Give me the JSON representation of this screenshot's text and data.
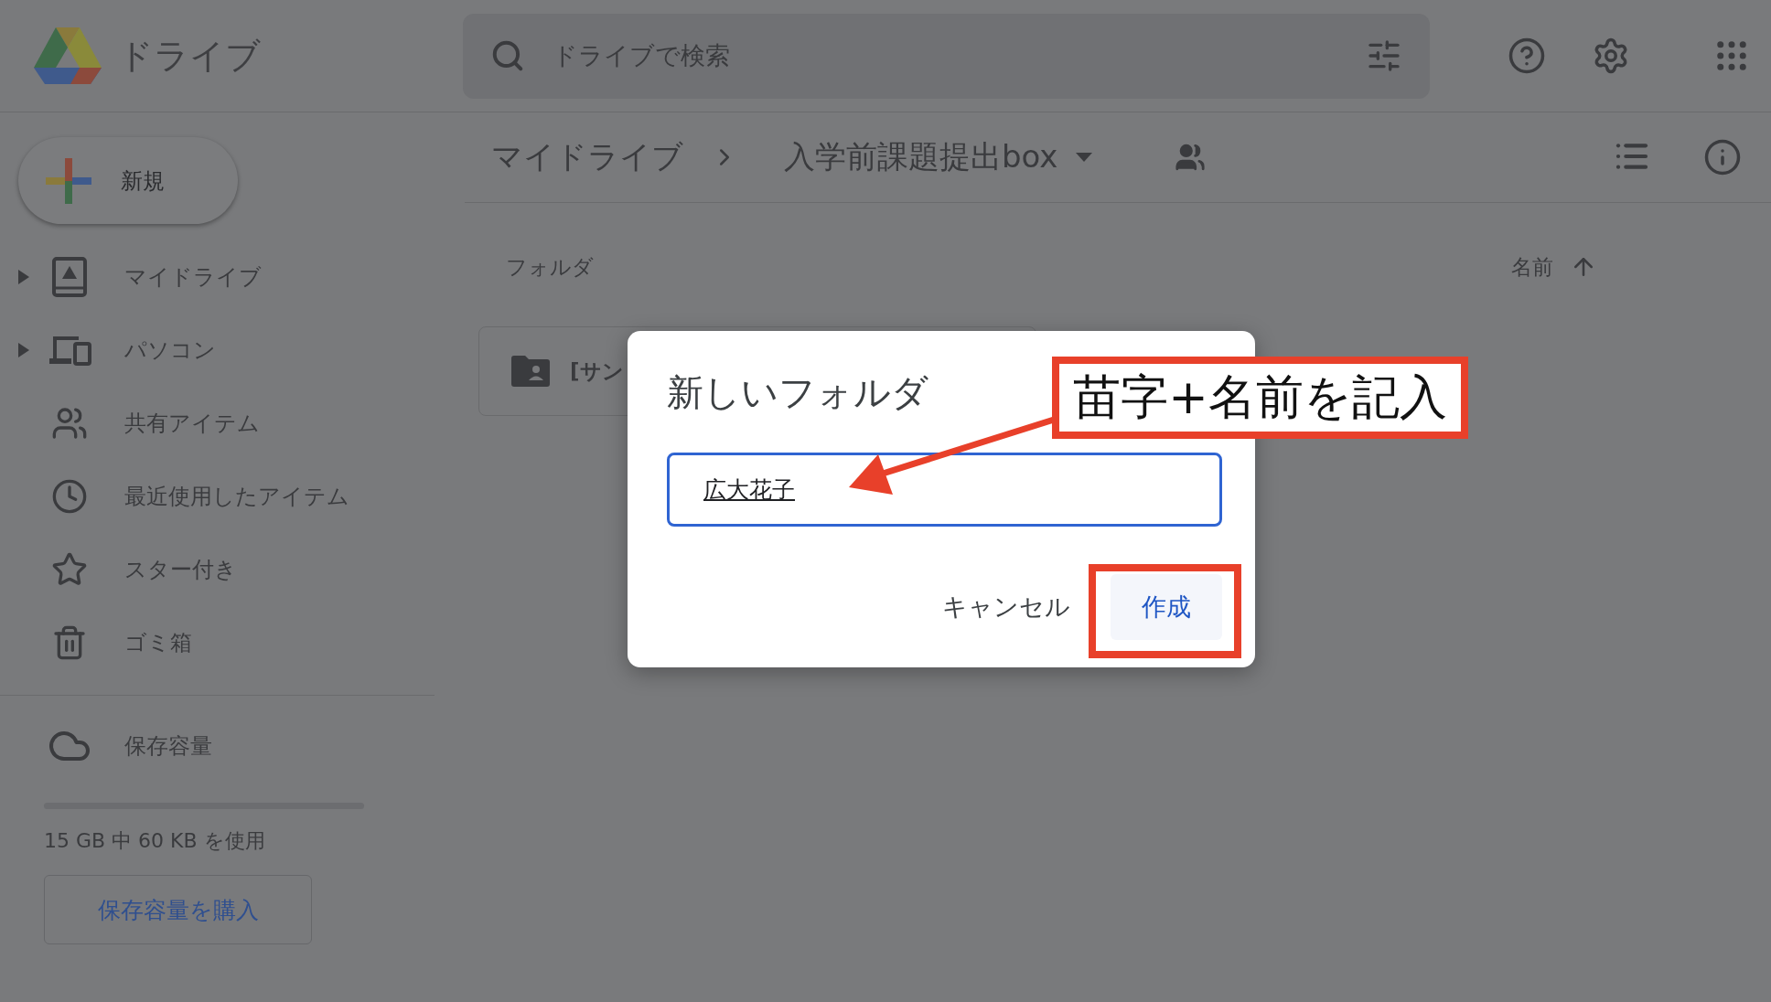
{
  "header": {
    "app_name": "ドライブ",
    "search": {
      "placeholder": "ドライブで検索"
    }
  },
  "breadcrumb": {
    "items": [
      "マイドライブ",
      "入学前課題提出box"
    ]
  },
  "sidebar": {
    "new_button": "新規",
    "items": [
      {
        "label": "マイドライブ",
        "kind": "drive",
        "expandable": true
      },
      {
        "label": "パソコン",
        "kind": "computer",
        "expandable": true
      },
      {
        "label": "共有アイテム",
        "kind": "shared",
        "expandable": false
      },
      {
        "label": "最近使用したアイテム",
        "kind": "recent",
        "expandable": false
      },
      {
        "label": "スター付き",
        "kind": "star",
        "expandable": false
      },
      {
        "label": "ゴミ箱",
        "kind": "trash",
        "expandable": false
      }
    ],
    "storage": {
      "label": "保存容量",
      "level": 0.0,
      "usage": "15 GB 中 60 KB を使用",
      "buy_button": "保存容量を購入"
    }
  },
  "content": {
    "section_title": "フォルダ",
    "sort_label": "名前",
    "folders": [
      {
        "name": "[サン"
      }
    ]
  },
  "dialog": {
    "title": "新しいフォルダ",
    "input": {
      "value": "広大花子"
    },
    "buttons": [
      {
        "label": "キャンセル",
        "kind": "text"
      },
      {
        "label": "作成",
        "kind": "primary"
      }
    ]
  },
  "annotation": {
    "text": "苗字+名前を記入"
  }
}
